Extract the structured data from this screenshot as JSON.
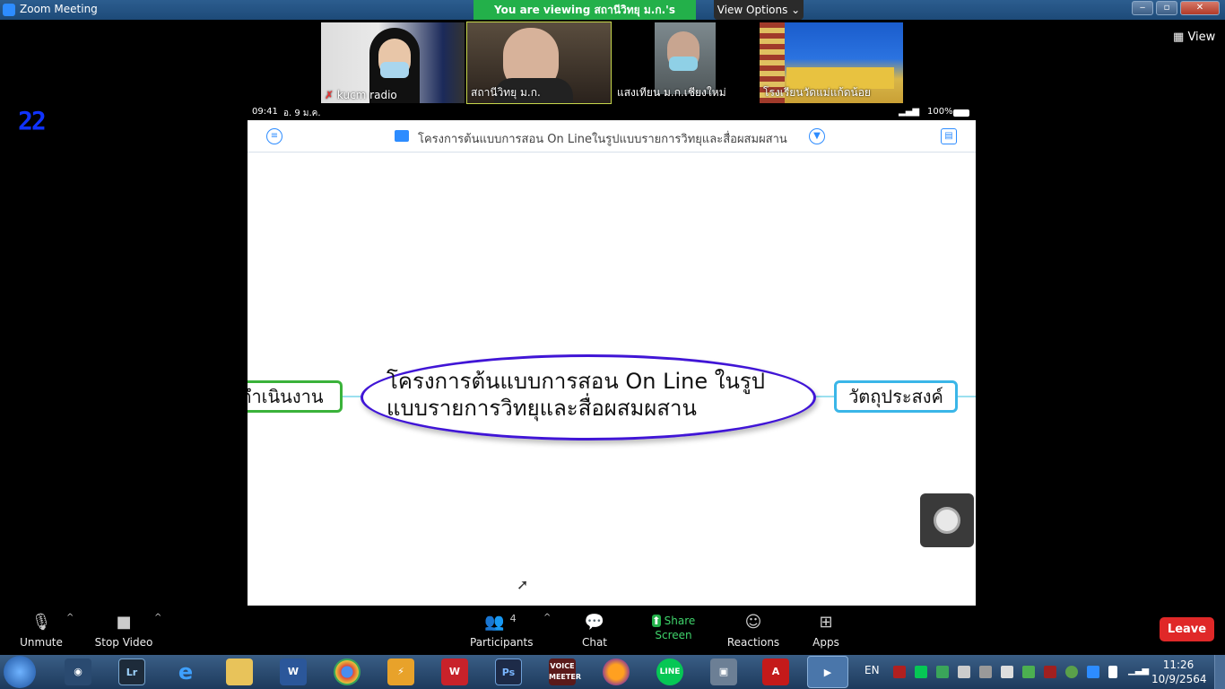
{
  "window": {
    "title": "Zoom Meeting",
    "viewing_banner": "You are viewing สถานีวิทยุ ม.ก.'s screen",
    "view_options": "View Options ⌄",
    "view_label": "View"
  },
  "participants_strip": [
    {
      "name": "kucm radio",
      "muted": true
    },
    {
      "name": "สถานีวิทยุ ม.ก.",
      "active": true
    },
    {
      "name": "แสงเทียน ม.ก.เชียงใหม่"
    },
    {
      "name": "โรงเรียนวัดแม่แก้ดน้อย"
    }
  ],
  "overlay_number": "22",
  "shared_screen": {
    "status_time": "09:41",
    "status_date": "อ. 9 ม.ค.",
    "battery": "100%",
    "doc_title": "โครงการต้นแบบการสอน On Lineในรูปแบบรายการวิทยุและสื่อผสมผสาน",
    "center_line1": "โครงการต้นแบบการสอน On Line ในรูป",
    "center_line2": "แบบรายการวิทยุและสื่อผสมผสาน",
    "left_node": "ดำเนินงาน",
    "right_node": "วัตถุประสงค์"
  },
  "toolbar": {
    "unmute": "Unmute",
    "stop_video": "Stop Video",
    "participants": "Participants",
    "participants_count": "4",
    "chat": "Chat",
    "share_screen": "Share Screen",
    "reactions": "Reactions",
    "apps": "Apps",
    "leave": "Leave"
  },
  "taskbar": {
    "lang": "EN",
    "time": "11:26",
    "date": "10/9/2564",
    "app_labels": {
      "lightroom": "Lr",
      "photoshop": "Ps",
      "voicemeeter": "VOICE MEETER"
    }
  }
}
